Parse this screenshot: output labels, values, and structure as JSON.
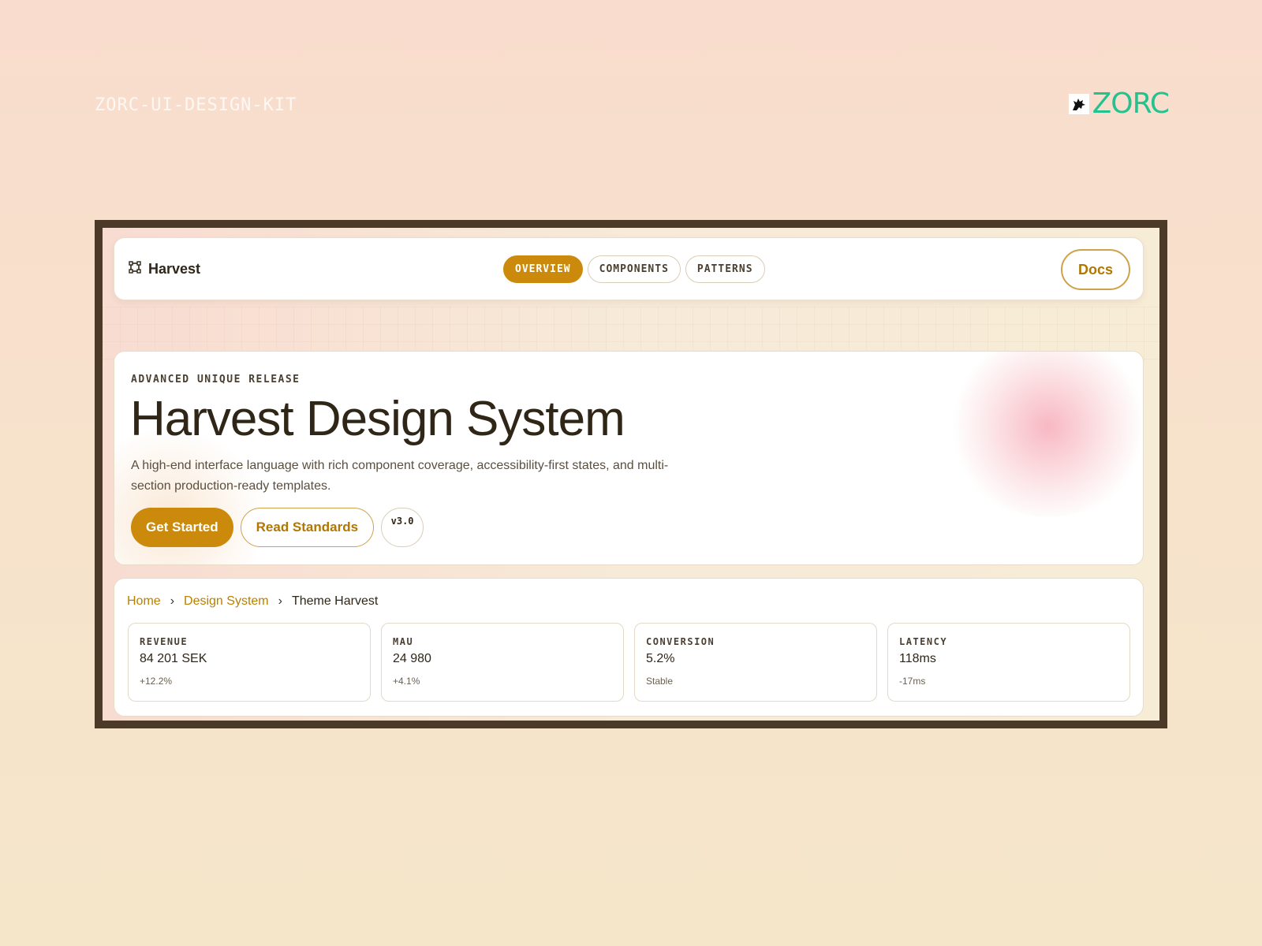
{
  "kit_label": "ZORC-UI-DESIGN-KIT",
  "brand": {
    "name": "ZORC",
    "color": "#23c28f"
  },
  "nav": {
    "logo_text": "Harvest",
    "tabs": [
      {
        "label": "OVERVIEW",
        "active": true
      },
      {
        "label": "COMPONENTS",
        "active": false
      },
      {
        "label": "PATTERNS",
        "active": false
      }
    ],
    "docs_label": "Docs"
  },
  "hero": {
    "eyebrow": "ADVANCED UNIQUE RELEASE",
    "title": "Harvest Design System",
    "description": "A high-end interface language with rich component coverage, accessibility-first states, and multi-section production-ready templates.",
    "primary_cta": "Get Started",
    "secondary_cta": "Read Standards",
    "version": "v3.0"
  },
  "breadcrumb": {
    "items": [
      "Home",
      "Design System"
    ],
    "current": "Theme Harvest"
  },
  "stats": [
    {
      "label": "REVENUE",
      "value": "84 201 SEK",
      "delta": "+12.2%"
    },
    {
      "label": "MAU",
      "value": "24 980",
      "delta": "+4.1%"
    },
    {
      "label": "CONVERSION",
      "value": "5.2%",
      "delta": "Stable"
    },
    {
      "label": "LATENCY",
      "value": "118ms",
      "delta": "-17ms"
    }
  ],
  "colors": {
    "accent": "#cc8a0c",
    "text": "#2f2617",
    "frame": "#4a3a27"
  }
}
